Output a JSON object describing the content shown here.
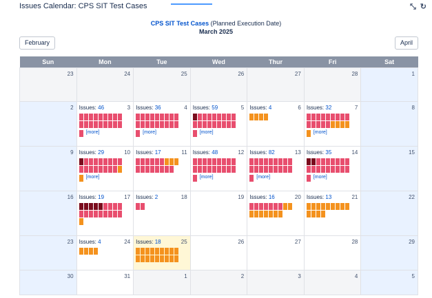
{
  "gadget": {
    "title": "Issues Calendar: CPS SIT Test Cases"
  },
  "header": {
    "filter_name": "CPS SIT Test Cases",
    "subtitle": "(Planned Execution Date)",
    "month": "March 2025"
  },
  "nav": {
    "prev_label": "February",
    "next_label": "April"
  },
  "weekdays": [
    "Sun",
    "Mon",
    "Tue",
    "Wed",
    "Thur",
    "Fri",
    "Sat"
  ],
  "issues_label": "Issues:",
  "more_label": "[more]",
  "colors": {
    "header": "#8993a4",
    "weekend": "#e9f2ff",
    "other_month": "#f4f5f7",
    "today": "#fff7d6",
    "status_red": "#e84e6e",
    "status_darkred": "#7a0c1d",
    "status_orange": "#f4921e",
    "link": "#0052cc"
  },
  "weeks": [
    [
      {
        "day": "23",
        "type": "other"
      },
      {
        "day": "24",
        "type": "other"
      },
      {
        "day": "25",
        "type": "other"
      },
      {
        "day": "26",
        "type": "other"
      },
      {
        "day": "27",
        "type": "other"
      },
      {
        "day": "28",
        "type": "other"
      },
      {
        "day": "1",
        "type": "weekend"
      }
    ],
    [
      {
        "day": "2",
        "type": "weekend"
      },
      {
        "day": "3",
        "count": "46",
        "blocks": "rrrrrrrrr rrrrrrrrr",
        "more": "r"
      },
      {
        "day": "4",
        "count": "36",
        "blocks": "rrrrrrrrr rrrrrrrrr",
        "more": "r"
      },
      {
        "day": "5",
        "count": "59",
        "blocks": "drrrrrrrr rrrrrrrrr",
        "more": "r"
      },
      {
        "day": "6",
        "count": "4",
        "blocks": "oooo"
      },
      {
        "day": "7",
        "count": "32",
        "blocks": "rrrrrrrrr rrrrroooo",
        "more": "o"
      },
      {
        "day": "8",
        "type": "weekend"
      }
    ],
    [
      {
        "day": "9",
        "type": "weekend"
      },
      {
        "day": "10",
        "count": "29",
        "blocks": "drrrrrrrr rrrrrrrro",
        "more": "o"
      },
      {
        "day": "11",
        "count": "17",
        "blocks": "rrrrrrooo rrrrrrrr"
      },
      {
        "day": "12",
        "count": "48",
        "blocks": "rrrrrrrrr rrrrrrrrr",
        "more": "r"
      },
      {
        "day": "13",
        "count": "82",
        "blocks": "rrrrrrrrr rrrrrrrrr",
        "more": "r"
      },
      {
        "day": "14",
        "count": "35",
        "blocks": "ddrrrrrrr rrrrrrrrr",
        "more": "r"
      },
      {
        "day": "15",
        "type": "weekend"
      }
    ],
    [
      {
        "day": "16",
        "type": "weekend"
      },
      {
        "day": "17",
        "count": "19",
        "blocks": "dddddrrrr rrrrrrrrr o"
      },
      {
        "day": "18",
        "count": "2",
        "blocks": "rr"
      },
      {
        "day": "19"
      },
      {
        "day": "20",
        "count": "16",
        "blocks": "rrrrrrroo ooooooo"
      },
      {
        "day": "21",
        "count": "13",
        "blocks": "ooooooooo oooo"
      },
      {
        "day": "22",
        "type": "weekend"
      }
    ],
    [
      {
        "day": "23",
        "type": "weekend"
      },
      {
        "day": "24",
        "count": "4",
        "blocks": "oooo"
      },
      {
        "day": "25",
        "count": "18",
        "type": "today",
        "blocks": "ooooooooo ooooooooo"
      },
      {
        "day": "26"
      },
      {
        "day": "27"
      },
      {
        "day": "28"
      },
      {
        "day": "29",
        "type": "weekend"
      }
    ],
    [
      {
        "day": "30",
        "type": "weekend"
      },
      {
        "day": "31"
      },
      {
        "day": "1",
        "type": "other"
      },
      {
        "day": "2",
        "type": "other"
      },
      {
        "day": "3",
        "type": "other"
      },
      {
        "day": "4",
        "type": "other"
      },
      {
        "day": "5",
        "type": "weekend"
      }
    ]
  ]
}
